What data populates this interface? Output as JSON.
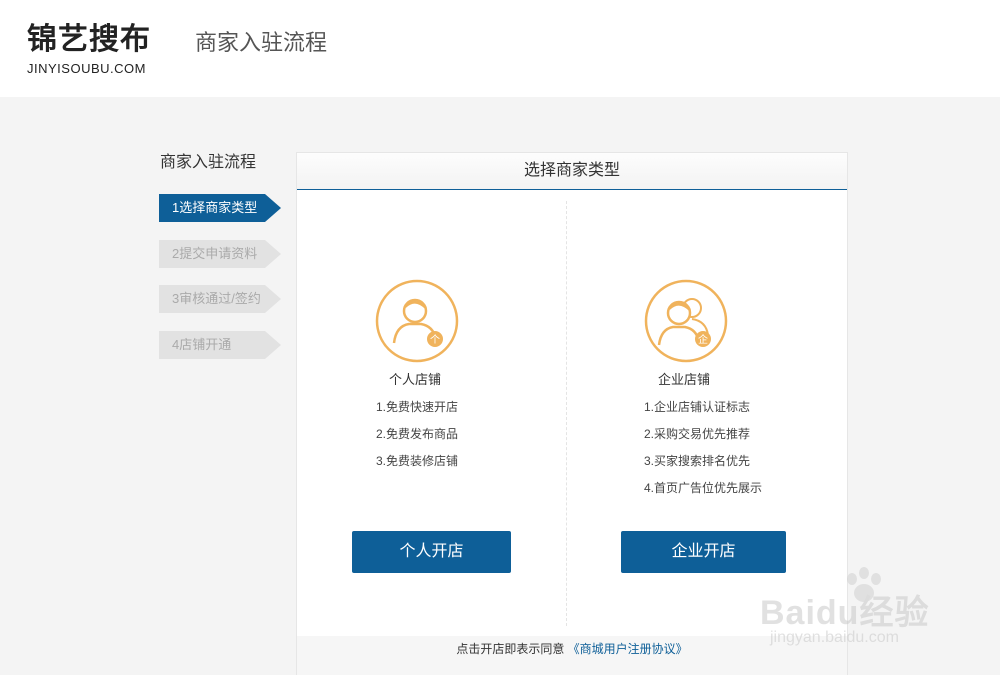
{
  "header": {
    "logo_text": "锦艺搜布",
    "logo_sub": "JINYISOUBU.COM",
    "title": "商家入驻流程"
  },
  "sidebar": {
    "title": "商家入驻流程",
    "steps": [
      {
        "label": "1选择商家类型",
        "active": true
      },
      {
        "label": "2提交申请资料",
        "active": false
      },
      {
        "label": "3审核通过/签约",
        "active": false
      },
      {
        "label": "4店铺开通",
        "active": false
      }
    ]
  },
  "panel": {
    "title": "选择商家类型",
    "personal": {
      "name": "个人店铺",
      "badge": "个",
      "benefits": [
        "1.免费快速开店",
        "2.免费发布商品",
        "3.免费装修店铺"
      ],
      "button": "个人开店"
    },
    "enterprise": {
      "name": "企业店铺",
      "badge": "企",
      "benefits": [
        "1.企业店铺认证标志",
        "2.采购交易优先推荐",
        "3.买家搜索排名优先",
        "4.首页广告位优先展示"
      ],
      "button": "企业开店"
    },
    "agreement": {
      "text": "点击开店即表示同意",
      "link": "《商城用户注册协议》"
    }
  },
  "watermark": {
    "text": "Baidu经验",
    "sub": "jingyan.baidu.com"
  },
  "colors": {
    "accent": "#0e5f98",
    "icon_orange": "#f0b35c",
    "step_inactive": "#e2e2e2"
  }
}
